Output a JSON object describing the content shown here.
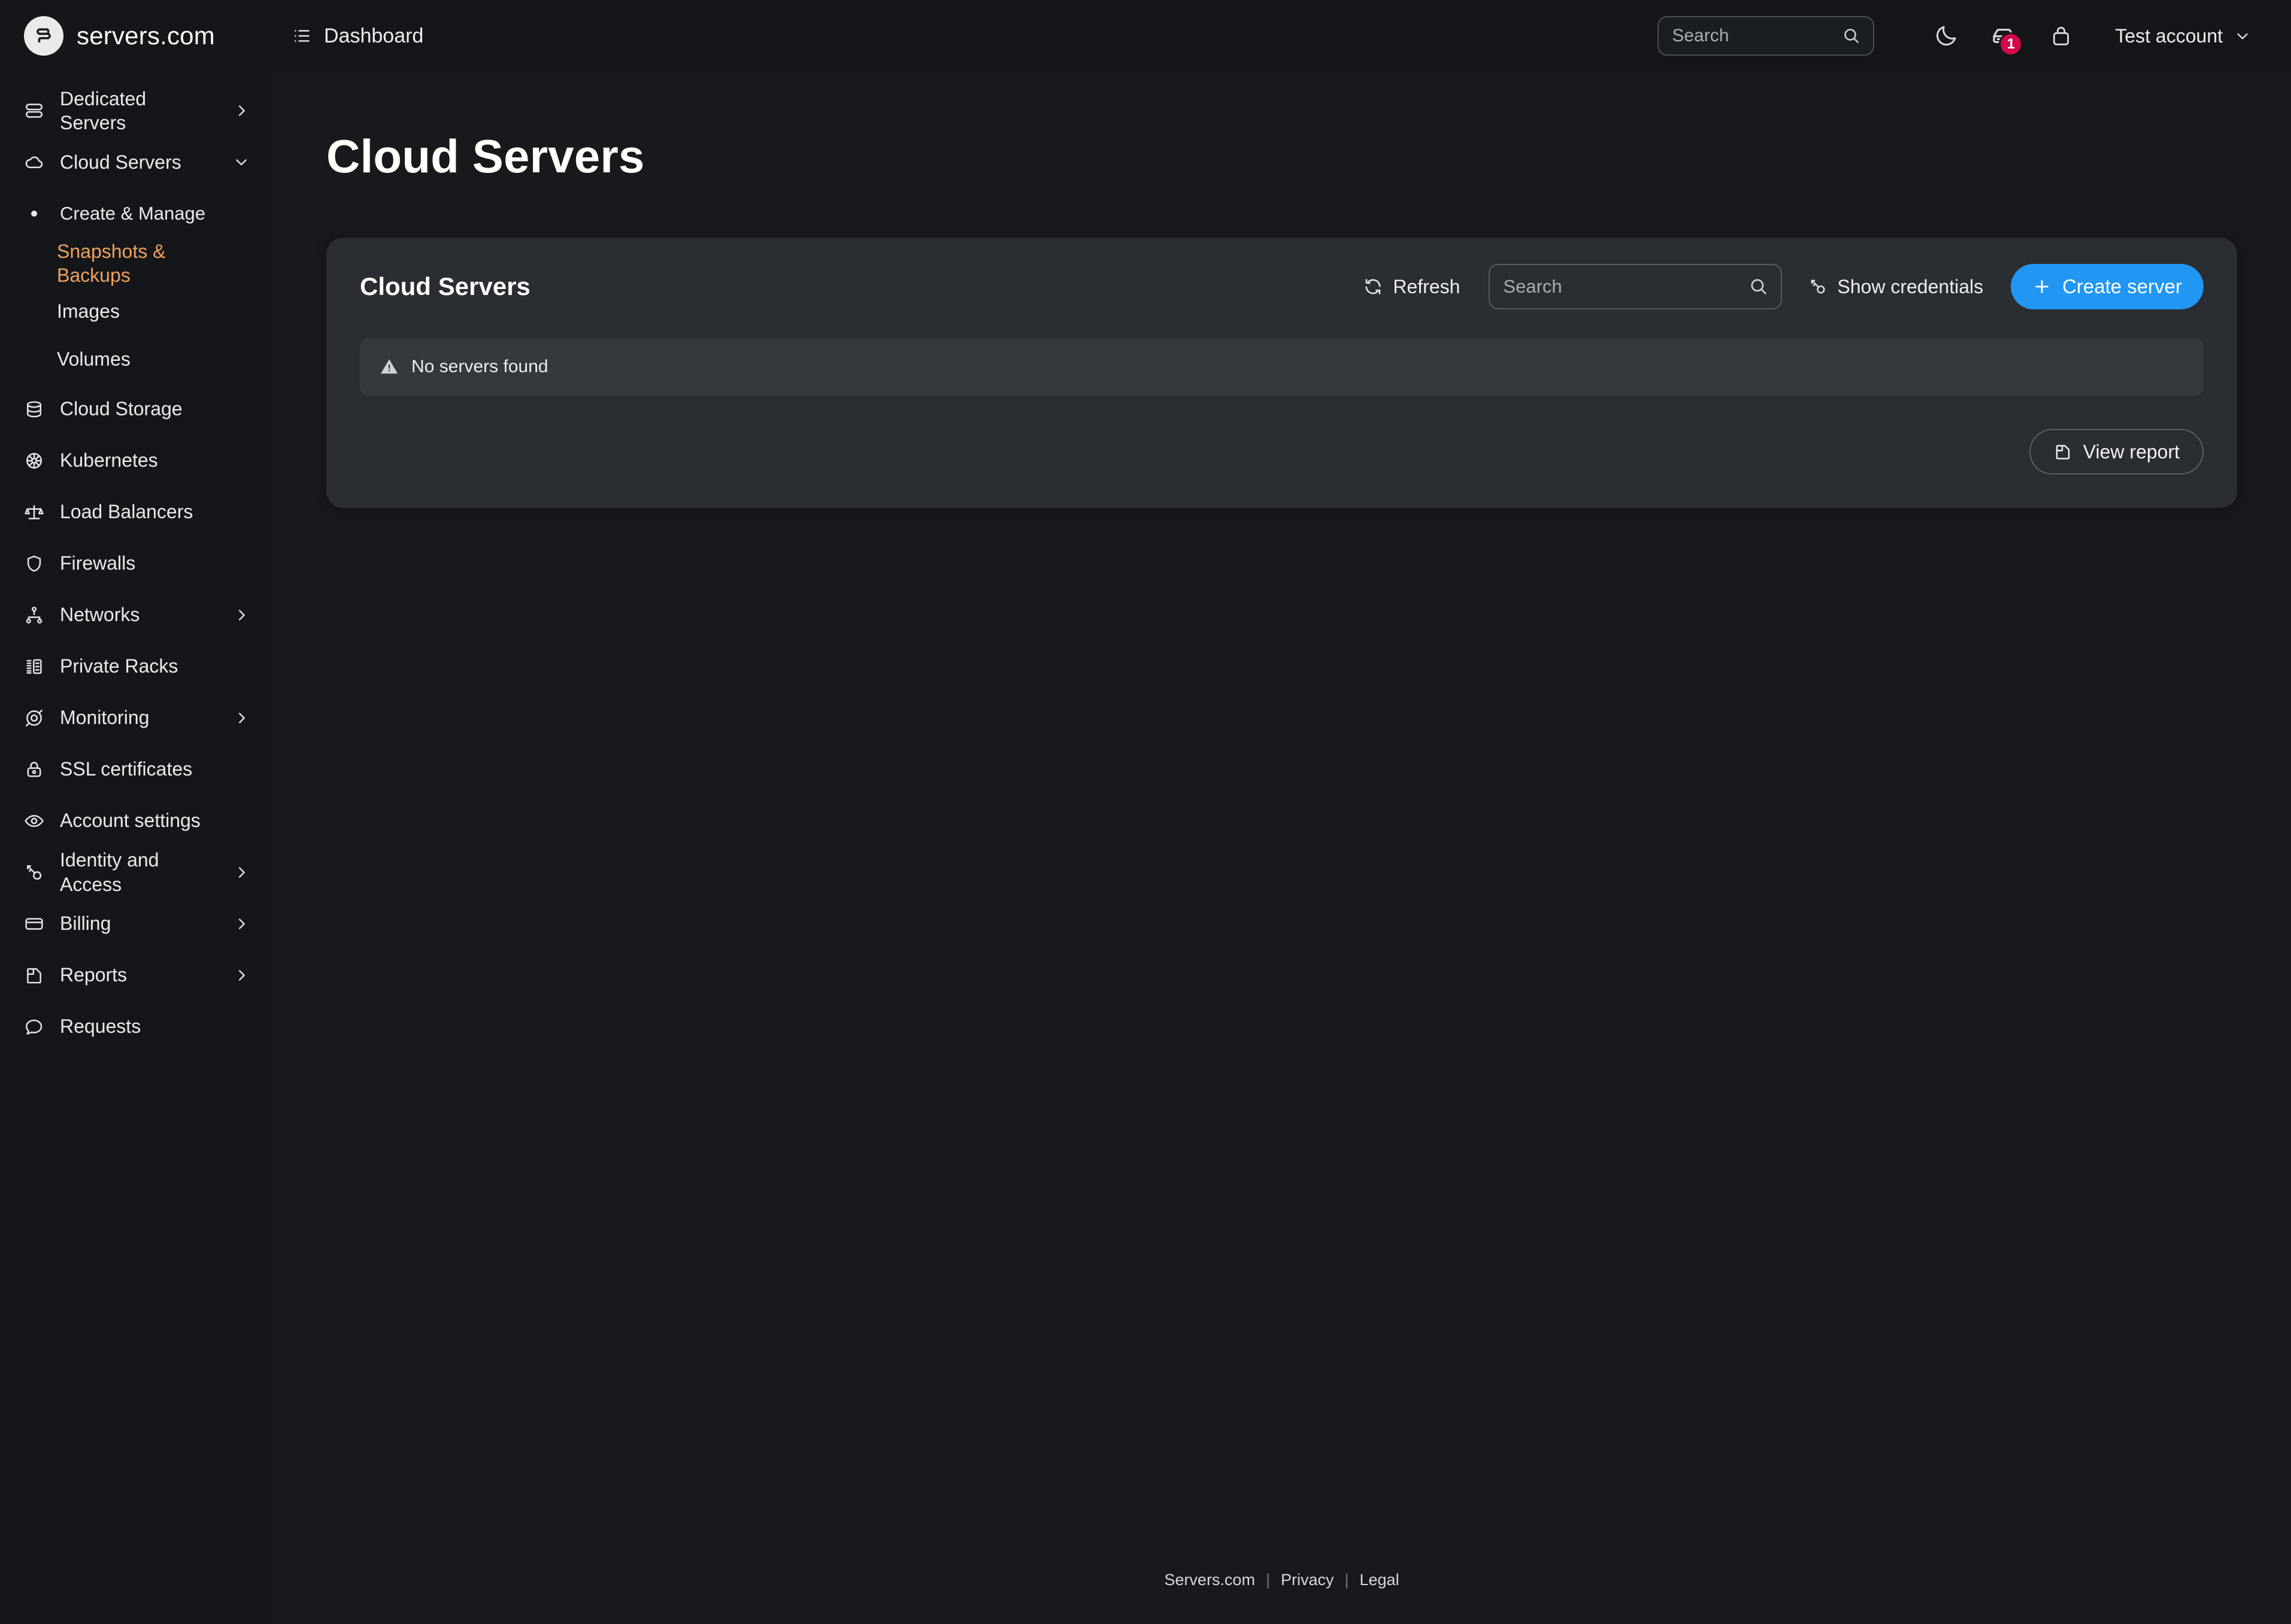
{
  "brand": {
    "name": "servers.com",
    "logo_icon": "servers-logo-icon"
  },
  "header": {
    "breadcrumb": {
      "icon": "list-icon",
      "label": "Dashboard"
    },
    "search": {
      "value": "",
      "placeholder": "Search",
      "icon": "search-icon"
    },
    "theme_toggle_icon": "moon-icon",
    "servers_icon": "server-icon",
    "servers_badge": "1",
    "cart_icon": "bag-icon",
    "account": {
      "label": "Test account",
      "chevron_icon": "chevron-down-icon"
    }
  },
  "sidebar": {
    "items": [
      {
        "label": "Dedicated Servers",
        "icon": "server-stack-icon",
        "chevron": "chevron-right-icon",
        "level": "top",
        "active": false
      },
      {
        "label": "Cloud Servers",
        "icon": "cloud-icon",
        "chevron": "chevron-down-icon",
        "level": "top",
        "active": false
      },
      {
        "label": "Create & Manage",
        "icon": "bullet-icon",
        "chevron": "",
        "level": "sub",
        "active": false
      },
      {
        "label": "Snapshots & Backups",
        "icon": "",
        "chevron": "",
        "level": "sub-indent",
        "active": true
      },
      {
        "label": "Images",
        "icon": "",
        "chevron": "",
        "level": "sub-indent",
        "active": false
      },
      {
        "label": "Volumes",
        "icon": "",
        "chevron": "",
        "level": "sub-indent",
        "active": false
      },
      {
        "label": "Cloud Storage",
        "icon": "database-icon",
        "chevron": "",
        "level": "top",
        "active": false
      },
      {
        "label": "Kubernetes",
        "icon": "kubernetes-icon",
        "chevron": "",
        "level": "top",
        "active": false
      },
      {
        "label": "Load Balancers",
        "icon": "scales-icon",
        "chevron": "",
        "level": "top",
        "active": false
      },
      {
        "label": "Firewalls",
        "icon": "shield-icon",
        "chevron": "",
        "level": "top",
        "active": false
      },
      {
        "label": "Networks",
        "icon": "network-icon",
        "chevron": "chevron-right-icon",
        "level": "top",
        "active": false
      },
      {
        "label": "Private Racks",
        "icon": "rack-icon",
        "chevron": "",
        "level": "top",
        "active": false
      },
      {
        "label": "Monitoring",
        "icon": "target-icon",
        "chevron": "chevron-right-icon",
        "level": "top",
        "active": false
      },
      {
        "label": "SSL certificates",
        "icon": "lock-icon",
        "chevron": "",
        "level": "top",
        "active": false
      },
      {
        "label": "Account settings",
        "icon": "eye-icon",
        "chevron": "",
        "level": "top",
        "active": false
      },
      {
        "label": "Identity and Access",
        "icon": "key-icon",
        "chevron": "chevron-right-icon",
        "level": "top",
        "active": false
      },
      {
        "label": "Billing",
        "icon": "card-icon",
        "chevron": "chevron-right-icon",
        "level": "top",
        "active": false
      },
      {
        "label": "Reports",
        "icon": "report-icon",
        "chevron": "chevron-right-icon",
        "level": "top",
        "active": false
      },
      {
        "label": "Requests",
        "icon": "chat-icon",
        "chevron": "",
        "level": "top",
        "active": false
      }
    ]
  },
  "main": {
    "page_title": "Cloud Servers",
    "card": {
      "title": "Cloud Servers",
      "refresh_label": "Refresh",
      "refresh_icon": "refresh-icon",
      "search": {
        "value": "",
        "placeholder": "Search",
        "icon": "search-icon"
      },
      "show_credentials_label": "Show credentials",
      "show_credentials_icon": "key-icon",
      "create_server_label": "Create server",
      "create_server_icon": "plus-icon",
      "alert": {
        "icon": "warning-icon",
        "text": "No servers found"
      },
      "view_report_label": "View report",
      "view_report_icon": "report-icon"
    }
  },
  "footer": {
    "links": [
      "Servers.com",
      "Privacy",
      "Legal"
    ],
    "separator": "|"
  },
  "colors": {
    "accent_orange": "#f0a15a",
    "primary_blue": "#2196f3",
    "badge_pink": "#d4094a",
    "page_bg": "#17191c",
    "sidebar_bg": "#141619",
    "card_bg": "#2a2d31",
    "alert_bg": "#35383d"
  }
}
